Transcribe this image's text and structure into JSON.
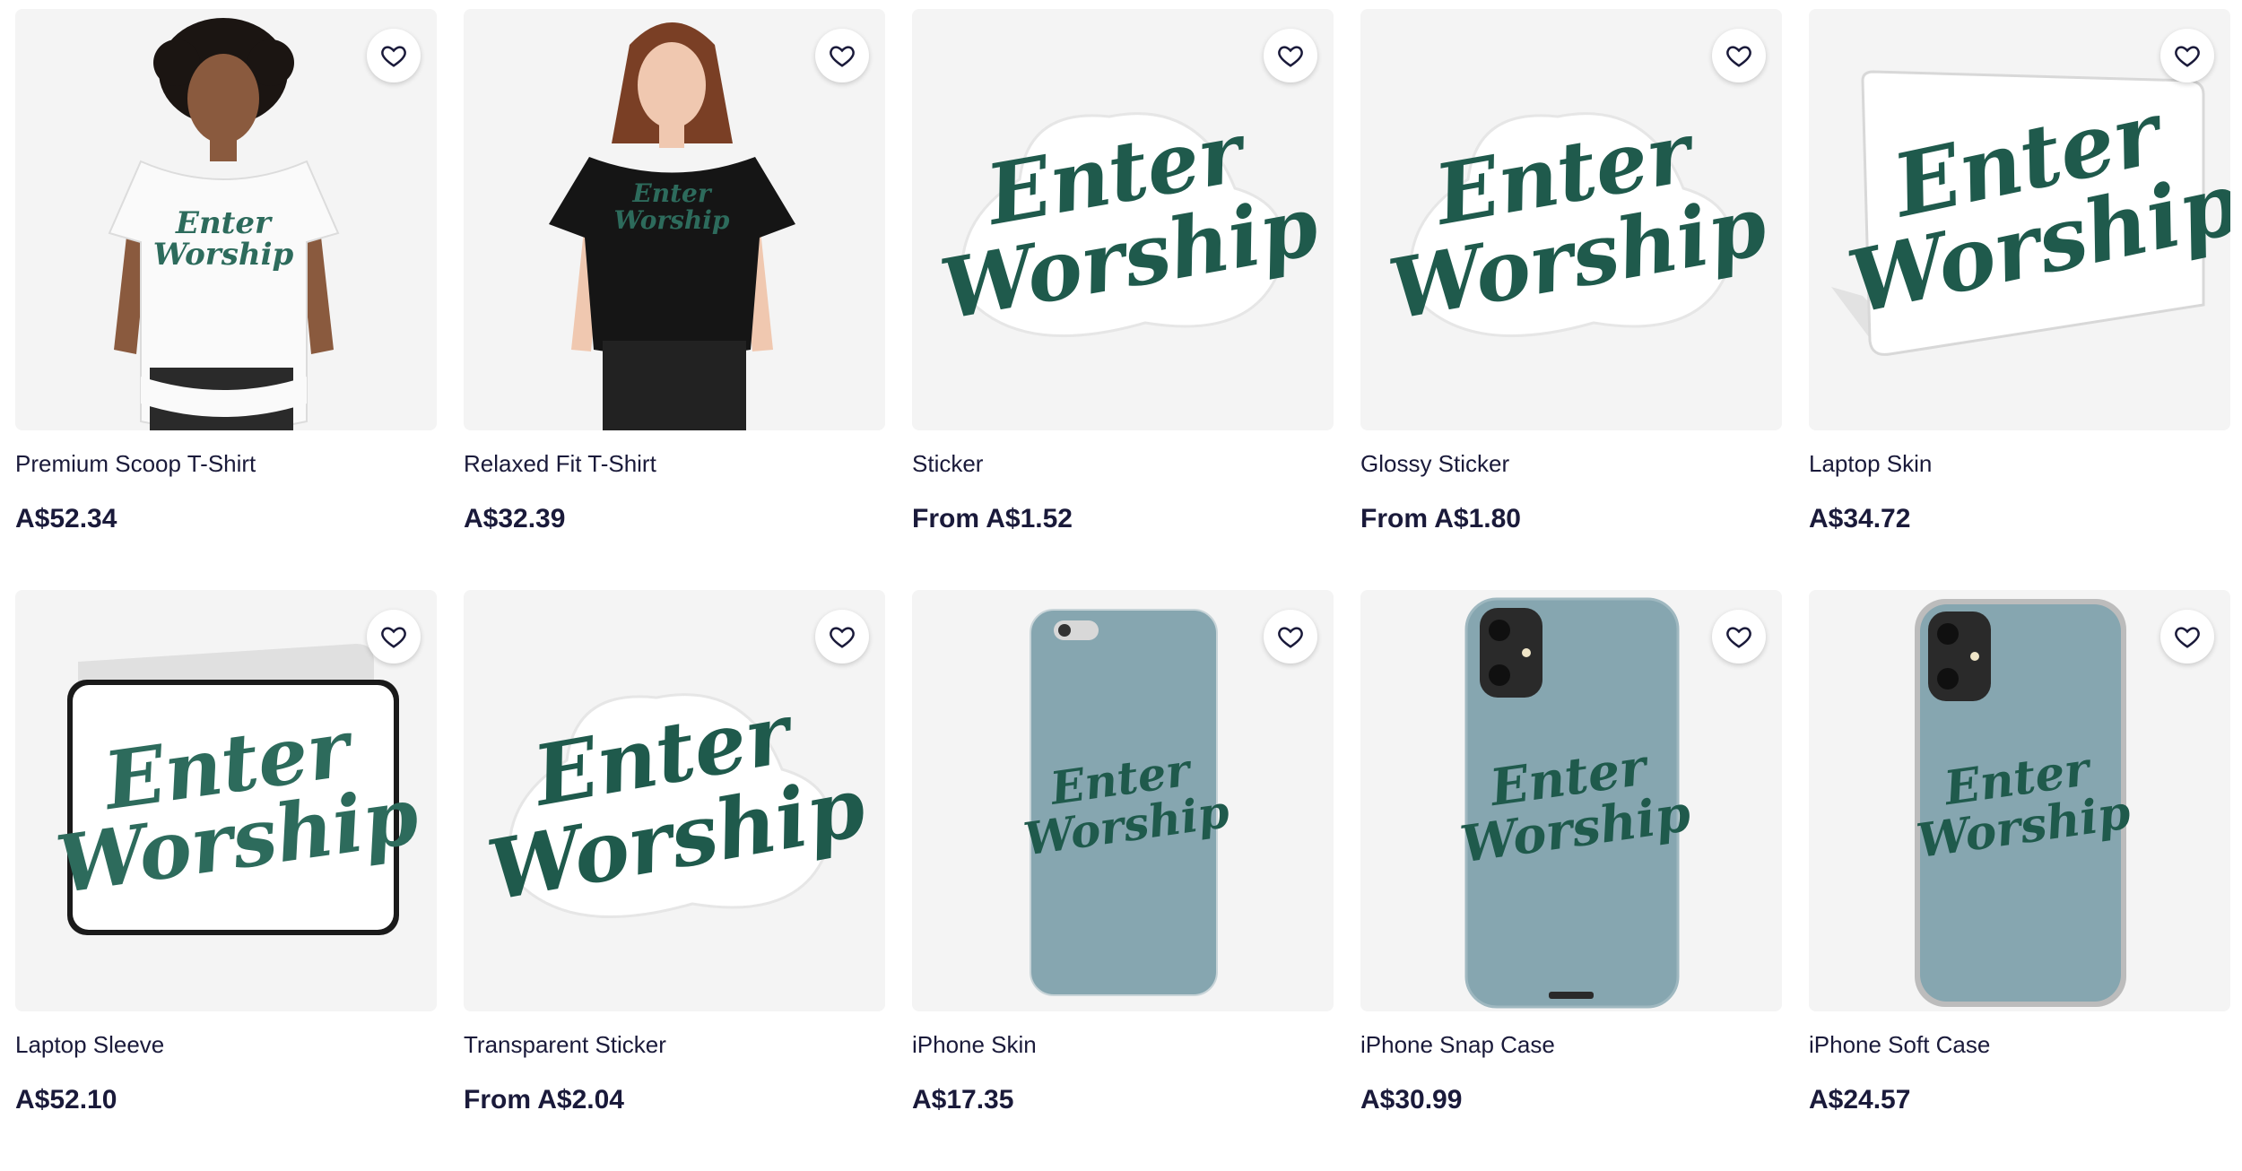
{
  "colors": {
    "ink": "#1a1a3a",
    "logo_green": "#1f5a4c",
    "tile_bg": "#f5f5f5",
    "phone_blue": "#86a6b0"
  },
  "products": [
    {
      "title": "Premium Scoop T-Shirt",
      "price": "A$52.34",
      "image": "white-scoop-tshirt-model",
      "logo_text": [
        "Enter",
        "Worship"
      ]
    },
    {
      "title": "Relaxed Fit T-Shirt",
      "price": "A$32.39",
      "image": "black-relaxed-tshirt-model",
      "logo_text": [
        "Enter",
        "Worship"
      ]
    },
    {
      "title": "Sticker",
      "price": "From A$1.52",
      "image": "sticker",
      "logo_text": [
        "Enter",
        "Worship"
      ]
    },
    {
      "title": "Glossy Sticker",
      "price": "From A$1.80",
      "image": "glossy-sticker",
      "logo_text": [
        "Enter",
        "Worship"
      ]
    },
    {
      "title": "Laptop Skin",
      "price": "A$34.72",
      "image": "laptop-skin",
      "logo_text": [
        "Enter",
        "Worship"
      ]
    },
    {
      "title": "Laptop Sleeve",
      "price": "A$52.10",
      "image": "laptop-sleeve",
      "logo_text": [
        "Enter",
        "Worship"
      ]
    },
    {
      "title": "Transparent Sticker",
      "price": "From A$2.04",
      "image": "transparent-sticker",
      "logo_text": [
        "Enter",
        "Worship"
      ]
    },
    {
      "title": "iPhone Skin",
      "price": "A$17.35",
      "image": "iphone-skin",
      "logo_text": [
        "Enter",
        "Worship"
      ]
    },
    {
      "title": "iPhone Snap Case",
      "price": "A$30.99",
      "image": "iphone-snap-case",
      "logo_text": [
        "Enter",
        "Worship"
      ]
    },
    {
      "title": "iPhone Soft Case",
      "price": "A$24.57",
      "image": "iphone-soft-case",
      "logo_text": [
        "Enter",
        "Worship"
      ]
    }
  ]
}
